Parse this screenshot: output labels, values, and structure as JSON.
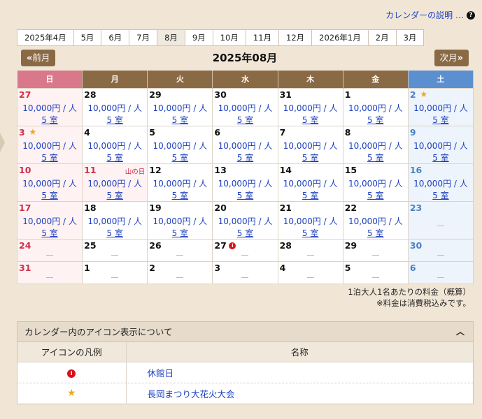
{
  "help": {
    "label": "カレンダーの説明 …",
    "icon_text": "?"
  },
  "month_tabs": [
    "2025年4月",
    "5月",
    "6月",
    "7月",
    "8月",
    "9月",
    "10月",
    "11月",
    "12月",
    "2026年1月",
    "2月",
    "3月"
  ],
  "active_tab": 4,
  "nav": {
    "prev": "前月",
    "next": "次月",
    "title": "2025年08月"
  },
  "weekdays": [
    "日",
    "月",
    "火",
    "水",
    "木",
    "金",
    "土"
  ],
  "price_text": "10,000円 / 人",
  "rooms_text": "5 室",
  "weeks": [
    [
      {
        "d": "27",
        "type": "sun",
        "avail": true
      },
      {
        "d": "28",
        "avail": true
      },
      {
        "d": "29",
        "avail": true
      },
      {
        "d": "30",
        "avail": true
      },
      {
        "d": "31",
        "avail": true
      },
      {
        "d": "1",
        "avail": true
      },
      {
        "d": "2",
        "type": "sat",
        "avail": true,
        "icon": "star"
      }
    ],
    [
      {
        "d": "3",
        "type": "sun",
        "avail": true,
        "icon": "star"
      },
      {
        "d": "4",
        "avail": true
      },
      {
        "d": "5",
        "avail": true
      },
      {
        "d": "6",
        "avail": true
      },
      {
        "d": "7",
        "avail": true
      },
      {
        "d": "8",
        "avail": true
      },
      {
        "d": "9",
        "type": "sat",
        "avail": true
      }
    ],
    [
      {
        "d": "10",
        "type": "sun",
        "avail": true
      },
      {
        "d": "11",
        "type": "hol",
        "avail": true,
        "holiday": "山の日"
      },
      {
        "d": "12",
        "avail": true
      },
      {
        "d": "13",
        "avail": true
      },
      {
        "d": "14",
        "avail": true
      },
      {
        "d": "15",
        "avail": true
      },
      {
        "d": "16",
        "type": "sat",
        "avail": true
      }
    ],
    [
      {
        "d": "17",
        "type": "sun",
        "avail": true
      },
      {
        "d": "18",
        "avail": true
      },
      {
        "d": "19",
        "avail": true
      },
      {
        "d": "20",
        "avail": true
      },
      {
        "d": "21",
        "avail": true
      },
      {
        "d": "22",
        "avail": true
      },
      {
        "d": "23",
        "type": "sat",
        "avail": false
      }
    ],
    [
      {
        "d": "24",
        "type": "sun",
        "avail": false
      },
      {
        "d": "25",
        "avail": false
      },
      {
        "d": "26",
        "avail": false
      },
      {
        "d": "27",
        "avail": false,
        "icon": "info"
      },
      {
        "d": "28",
        "avail": false
      },
      {
        "d": "29",
        "avail": false
      },
      {
        "d": "30",
        "type": "sat",
        "avail": false
      }
    ],
    [
      {
        "d": "31",
        "type": "sun",
        "avail": false
      },
      {
        "d": "1",
        "avail": false
      },
      {
        "d": "2",
        "avail": false
      },
      {
        "d": "3",
        "avail": false
      },
      {
        "d": "4",
        "avail": false
      },
      {
        "d": "5",
        "avail": false
      },
      {
        "d": "6",
        "type": "sat",
        "avail": false
      }
    ]
  ],
  "notes": [
    "1泊大人1名あたりの料金（概算）",
    "※料金は消費税込みです。"
  ],
  "legend": {
    "title": "カレンダー内のアイコン表示について",
    "col_icon": "アイコンの凡例",
    "col_name": "名称",
    "info_icon_text": "i",
    "rows": [
      {
        "icon": "info",
        "name": "休館日"
      },
      {
        "icon": "star",
        "name": "長岡まつり大花火大会"
      }
    ]
  },
  "colors": {
    "brown": "#8a6a45",
    "sunday": "#d8788a",
    "saturday": "#5b8fcf",
    "link": "#1b3fbf",
    "star": "#f0a61b",
    "info": "#d8131a"
  }
}
